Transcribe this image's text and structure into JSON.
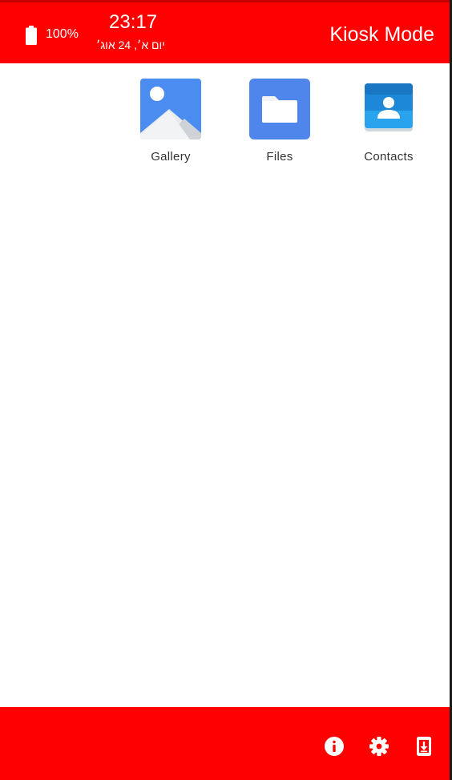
{
  "status_bar": {
    "battery_percent": "100%",
    "battery_level": 1.0,
    "time": "23:17",
    "date": "יום א׳, 24 אוג׳",
    "title": "Kiosk Mode"
  },
  "apps": [
    {
      "label": "Gallery",
      "icon": "gallery-icon"
    },
    {
      "label": "Files",
      "icon": "folder-icon"
    },
    {
      "label": "Contacts",
      "icon": "contacts-icon"
    }
  ],
  "bottom_bar": {
    "buttons": [
      {
        "icon": "info-icon"
      },
      {
        "icon": "gear-icon"
      },
      {
        "icon": "exit-kiosk-icon"
      }
    ]
  },
  "colors": {
    "bar": "#ff0000",
    "background": "#ffffff",
    "gallery_blue": "#4a8cf0",
    "files_blue": "#4f86ec",
    "contacts_blue": "#1e88d8"
  }
}
